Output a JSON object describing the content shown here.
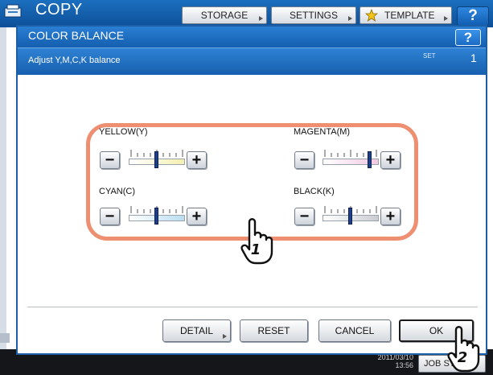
{
  "background": {
    "app_title": "COPY",
    "tabs": [
      {
        "label": "STORAGE"
      },
      {
        "label": "SETTINGS"
      },
      {
        "label": "TEMPLATE",
        "icon": "star-icon"
      }
    ],
    "help_label": "?",
    "datetime": "2011/03/10\n13:56",
    "job_status_label": "JOB STATUS"
  },
  "dialog": {
    "title": "COLOR BALANCE",
    "help_label": "?",
    "instruction": "Adjust Y,M,C,K balance",
    "set_label": "SET",
    "set_number": "1"
  },
  "adjusters": [
    {
      "label": "YELLOW(Y)",
      "level": 0,
      "track_color": "#f4f0b0"
    },
    {
      "label": "MAGENTA(M)",
      "level": 3,
      "track_color": "#f2c8e0"
    },
    {
      "label": "CYAN(C)",
      "level": 0,
      "track_color": "#b9ddf0"
    },
    {
      "label": "BLACK(K)",
      "level": 0,
      "track_color": "#c9cdd2"
    }
  ],
  "slider_range": {
    "min": -4,
    "max": 4
  },
  "step": {
    "minus": "−",
    "plus": "+"
  },
  "buttons": {
    "detail": "DETAIL",
    "reset": "RESET",
    "cancel": "CANCEL",
    "ok": "OK"
  },
  "callouts": [
    "1",
    "2"
  ],
  "colors": {
    "header_blue": "#1a66b8",
    "highlight": "#ee8f72",
    "thumb": "#1f3f87"
  }
}
